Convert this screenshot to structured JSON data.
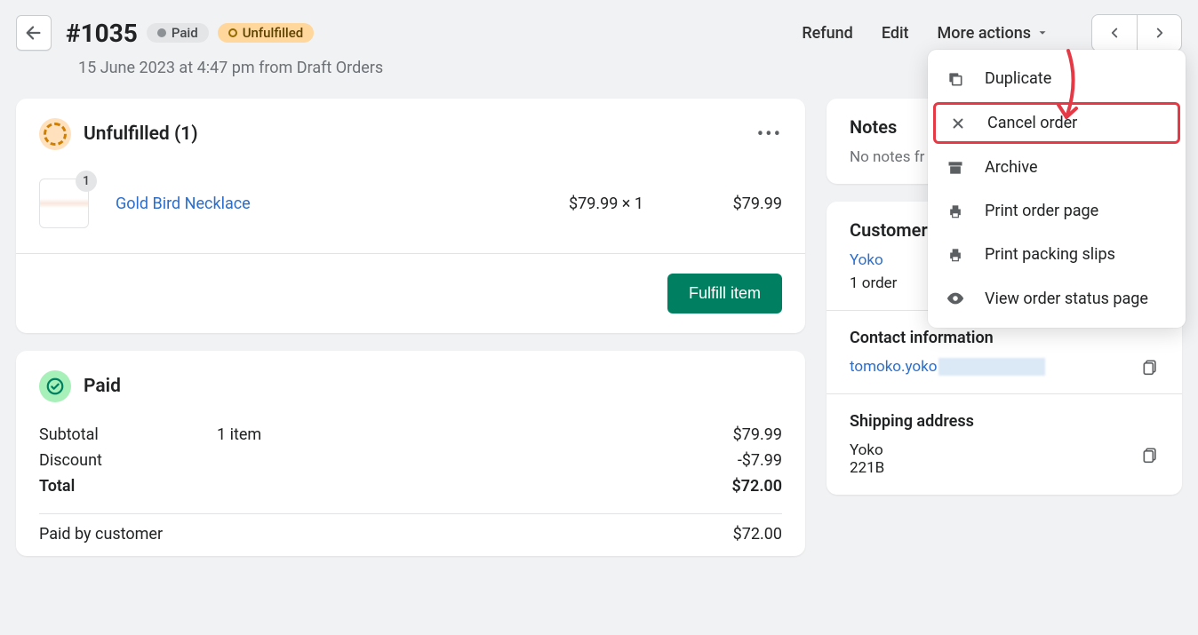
{
  "header": {
    "order_number": "#1035",
    "paid_badge": "Paid",
    "fulfillment_badge": "Unfulfilled",
    "subtitle": "15 June 2023 at 4:47 pm from Draft Orders",
    "refund": "Refund",
    "edit": "Edit",
    "more_actions": "More actions"
  },
  "fulfillment": {
    "title": "Unfulfilled (1)",
    "item": {
      "name": "Gold Bird Necklace",
      "qty_badge": "1",
      "price_qty": "$79.99 × 1",
      "line_total": "$79.99"
    },
    "button": "Fulfill item"
  },
  "payment": {
    "title": "Paid",
    "rows": {
      "subtotal_label": "Subtotal",
      "subtotal_desc": "1 item",
      "subtotal_amount": "$79.99",
      "discount_label": "Discount",
      "discount_amount": "-$7.99",
      "total_label": "Total",
      "total_amount": "$72.00",
      "paid_by_label": "Paid by customer",
      "paid_by_amount": "$72.00"
    }
  },
  "sidebar": {
    "notes_title": "Notes",
    "notes_empty": "No notes fr",
    "customer_title": "Customer",
    "customer_name": "Yoko",
    "customer_orders": "1 order",
    "contact_title": "Contact information",
    "contact_email_prefix": "tomoko.yoko",
    "shipping_title": "Shipping address",
    "shipping_name": "Yoko",
    "shipping_line1": "221B"
  },
  "popover": {
    "duplicate": "Duplicate",
    "cancel": "Cancel order",
    "archive": "Archive",
    "print_order": "Print order page",
    "print_slips": "Print packing slips",
    "view_status": "View order status page"
  }
}
